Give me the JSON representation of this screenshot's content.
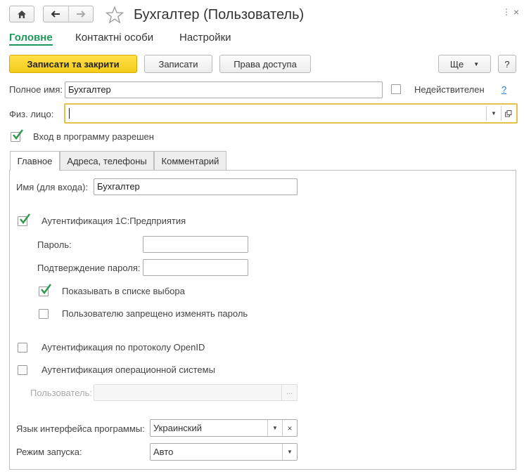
{
  "window": {
    "title": "Бухгалтер (Пользователь)"
  },
  "nav_tabs": {
    "main": "Головне",
    "contacts": "Контактні особи",
    "settings": "Настройки"
  },
  "toolbar": {
    "save_close": "Записати та закрити",
    "save": "Записати",
    "access_rights": "Права доступа",
    "more": "Ще",
    "help": "?"
  },
  "form": {
    "full_name_label": "Полное имя:",
    "full_name_value": "Бухгалтер",
    "inactive_label": "Недействителен",
    "inactive_help": "?",
    "person_label": "Физ. лицо:",
    "person_value": "",
    "login_allowed_label": "Вход в программу разрешен"
  },
  "inner_tabs": {
    "main": "Главное",
    "addresses": "Адреса, телефоны",
    "comment": "Комментарий"
  },
  "main_tab": {
    "login_name_label": "Имя (для входа):",
    "login_name_value": "Бухгалтер",
    "auth_1c_label": "Аутентификация 1С:Предприятия",
    "password_label": "Пароль:",
    "password_value": "",
    "password_confirm_label": "Подтверждение пароля:",
    "password_confirm_value": "",
    "show_in_list_label": "Показывать в списке выбора",
    "forbid_change_password_label": "Пользователю запрещено изменять пароль",
    "auth_openid_label": "Аутентификация по протоколу OpenID",
    "auth_os_label": "Аутентификация операционной системы",
    "os_user_label": "Пользователь:",
    "os_user_value": "",
    "os_user_btn": "...",
    "interface_lang_label": "Язык интерфейса программы:",
    "interface_lang_value": "Украинский",
    "launch_mode_label": "Режим запуска:",
    "launch_mode_value": "Авто"
  },
  "colors": {
    "accent_green": "#1d9a5b",
    "highlight_yellow": "#f5cc1a",
    "focus_border": "#e5c14a"
  }
}
